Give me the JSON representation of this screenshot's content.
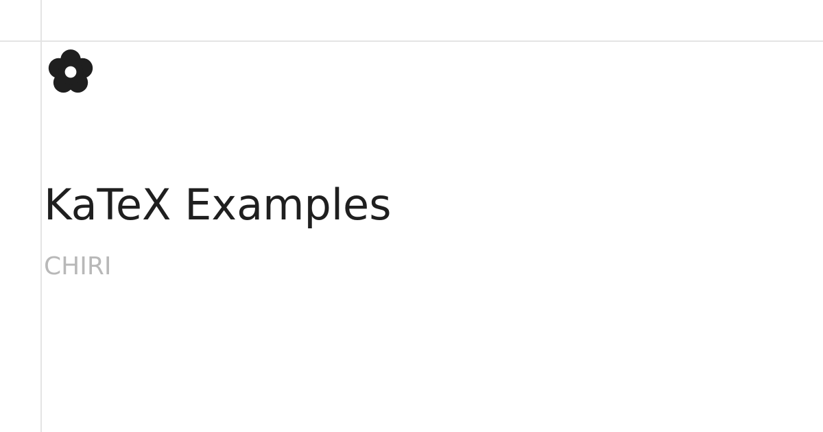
{
  "page": {
    "title": "KaTeX Examples",
    "author": "CHIRI"
  },
  "logo": {
    "icon": "flower-icon",
    "color": "#1f1f1f"
  },
  "colors": {
    "background": "#ffffff",
    "guide": "#e4e4e4",
    "title": "#1f1f1f",
    "author": "#b8b8b8"
  }
}
